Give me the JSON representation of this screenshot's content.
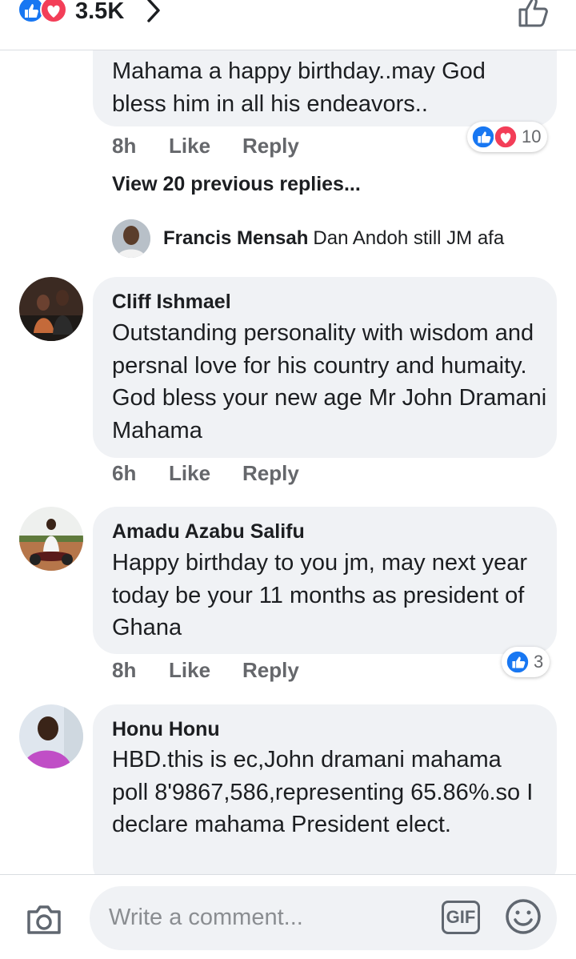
{
  "header": {
    "reaction_count": "3.5K",
    "icons": [
      "like-icon",
      "love-icon",
      "chevron-right-icon",
      "thumbs-up-outline-icon"
    ]
  },
  "comments": [
    {
      "id": "top-partial",
      "text": "Mahama a happy birthday..may God bless him in all his endeavors..",
      "time": "8h",
      "like_label": "Like",
      "reply_label": "Reply",
      "reactions": {
        "count": "10",
        "types": [
          "like",
          "love"
        ]
      }
    },
    {
      "id": "cliff",
      "name": "Cliff Ishmael",
      "text": "Outstanding personality with wisdom and persnal love for his country and humaity. God bless your new age Mr John Dramani Mahama",
      "time": "6h",
      "like_label": "Like",
      "reply_label": "Reply"
    },
    {
      "id": "amadu",
      "name": "Amadu Azabu Salifu",
      "text": "Happy birthday to you jm, may next year today be your 11 months as president of Ghana",
      "time": "8h",
      "like_label": "Like",
      "reply_label": "Reply",
      "reactions": {
        "count": "3",
        "types": [
          "like"
        ]
      }
    },
    {
      "id": "honu",
      "name": "Honu Honu",
      "text": "HBD.this is ec,John dramani mahama poll 8'9867,586,representing 65.86%.so I declare mahama President elect."
    }
  ],
  "view_previous": "View 20 previous replies...",
  "reply_preview": {
    "name": "Francis Mensah",
    "text": "Dan Andoh still JM afa"
  },
  "composer": {
    "placeholder": "Write a comment...",
    "gif_label": "GIF"
  },
  "colors": {
    "like_blue": "#1877f2",
    "love_red": "#f33e58",
    "bubble_gray": "#f0f2f5",
    "meta_gray": "#65676b"
  }
}
